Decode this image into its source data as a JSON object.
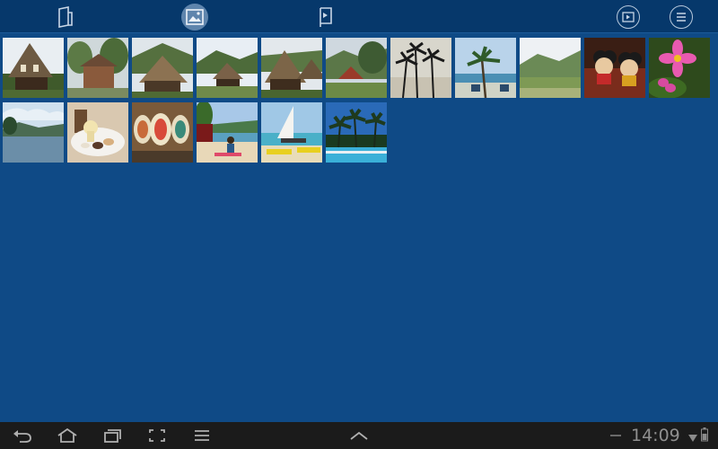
{
  "topbar": {
    "tabs": [
      {
        "icon": "album-icon",
        "selected": false
      },
      {
        "icon": "gallery-icon",
        "selected": true
      },
      {
        "icon": "flag-icon",
        "selected": false
      }
    ],
    "actions": [
      {
        "icon": "slideshow-icon"
      },
      {
        "icon": "menu-icon"
      }
    ]
  },
  "gallery": {
    "photos": [
      {
        "scene": "thatched-house"
      },
      {
        "scene": "house-trees"
      },
      {
        "scene": "thatched-house-hill"
      },
      {
        "scene": "village-field"
      },
      {
        "scene": "thatched-house-close"
      },
      {
        "scene": "house-pine"
      },
      {
        "scene": "palm-silhouette"
      },
      {
        "scene": "beach-palm"
      },
      {
        "scene": "mountain-meadow"
      },
      {
        "scene": "mickey-plush"
      },
      {
        "scene": "pink-flower"
      },
      {
        "scene": "lake-sky"
      },
      {
        "scene": "dessert-plate"
      },
      {
        "scene": "painted-plates"
      },
      {
        "scene": "beach-people"
      },
      {
        "scene": "sailboat-beach"
      },
      {
        "scene": "pool-palms"
      }
    ]
  },
  "status_bar": {
    "time": "14:09"
  },
  "colors": {
    "background": "#0f4a86",
    "toolbar": "#06386b",
    "navbar": "#1b1b1b"
  }
}
